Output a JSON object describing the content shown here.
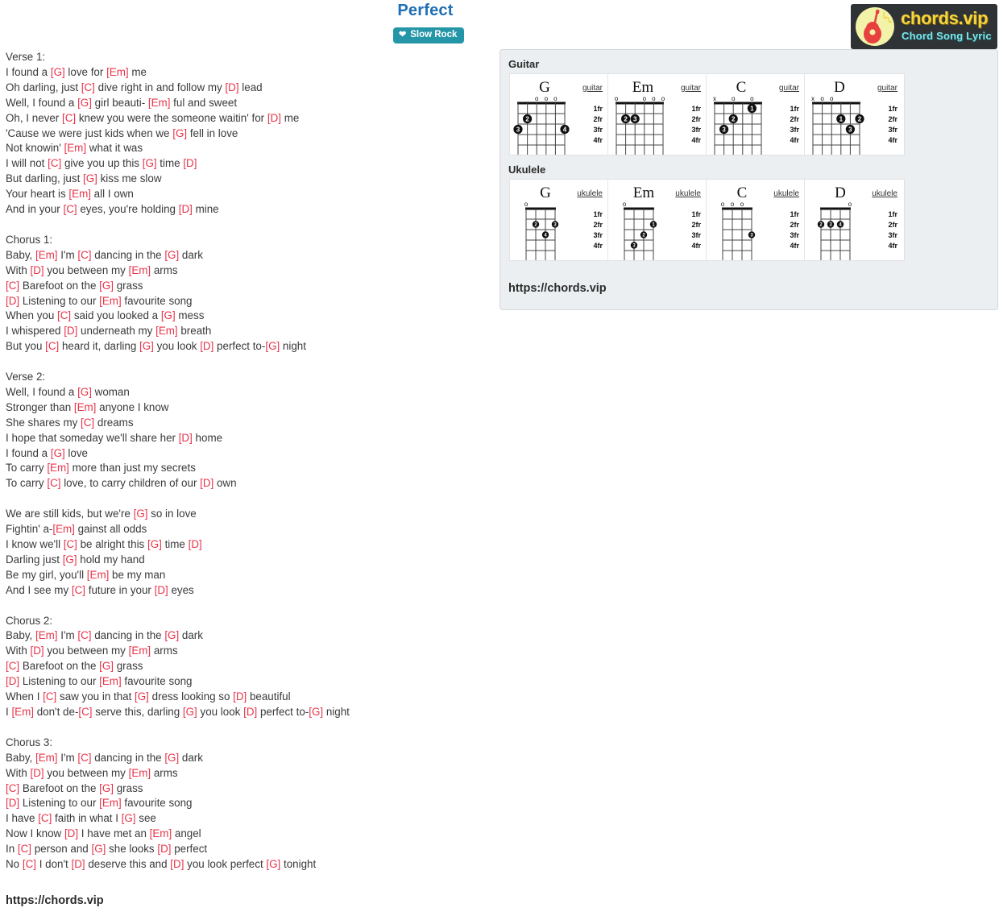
{
  "header": {
    "title": "Perfect",
    "rhythm_badge": "Slow Rock",
    "rhythm_icon": "heart-icon"
  },
  "logo": {
    "brand": "chords.vip",
    "tagline": "Chord Song Lyric",
    "icon": "guitar-icon",
    "brand_color": "#f5d442",
    "tagline_color": "#7fe3e8",
    "background_color": "#2f3336"
  },
  "colors": {
    "title": "#1f6fb5",
    "badge": "#2596a8",
    "chord": "#e8344a",
    "lyric": "#3a3a3a",
    "panel_bg": "#eceff1"
  },
  "bottom_url": "https://chords.vip",
  "chord_panel": {
    "guitar_label": "Guitar",
    "ukulele_label": "Ukulele",
    "url": "https://chords.vip",
    "guitar": [
      {
        "name": "G",
        "instrument": "guitar",
        "strings": 6,
        "frets": 4,
        "fret_labels": [
          "1fr",
          "2fr",
          "3fr",
          "4fr"
        ],
        "open": [
          3,
          4,
          5
        ],
        "muted": [],
        "dots": [
          {
            "string": 2,
            "fret": 2,
            "finger": "2"
          },
          {
            "string": 1,
            "fret": 3,
            "finger": "3"
          },
          {
            "string": 6,
            "fret": 3,
            "finger": "4"
          }
        ]
      },
      {
        "name": "Em",
        "instrument": "guitar",
        "strings": 6,
        "frets": 4,
        "fret_labels": [
          "1fr",
          "2fr",
          "3fr",
          "4fr"
        ],
        "open": [
          1,
          4,
          5,
          6
        ],
        "muted": [],
        "dots": [
          {
            "string": 2,
            "fret": 2,
            "finger": "2"
          },
          {
            "string": 3,
            "fret": 2,
            "finger": "3"
          }
        ]
      },
      {
        "name": "C",
        "instrument": "guitar",
        "strings": 6,
        "frets": 4,
        "fret_labels": [
          "1fr",
          "2fr",
          "3fr",
          "4fr"
        ],
        "open": [
          3,
          5
        ],
        "muted": [
          1
        ],
        "dots": [
          {
            "string": 5,
            "fret": 1,
            "finger": "1"
          },
          {
            "string": 3,
            "fret": 2,
            "finger": "2"
          },
          {
            "string": 2,
            "fret": 3,
            "finger": "3"
          }
        ]
      },
      {
        "name": "D",
        "instrument": "guitar",
        "strings": 6,
        "frets": 4,
        "fret_labels": [
          "1fr",
          "2fr",
          "3fr",
          "4fr"
        ],
        "open": [
          2,
          3
        ],
        "muted": [
          1
        ],
        "dots": [
          {
            "string": 4,
            "fret": 2,
            "finger": "1"
          },
          {
            "string": 6,
            "fret": 2,
            "finger": "2"
          },
          {
            "string": 5,
            "fret": 3,
            "finger": "3"
          }
        ]
      }
    ],
    "ukulele": [
      {
        "name": "G",
        "instrument": "ukulele",
        "strings": 4,
        "frets": 4,
        "fret_labels": [
          "1fr",
          "2fr",
          "3fr",
          "4fr"
        ],
        "open": [
          1
        ],
        "muted": [],
        "dots": [
          {
            "string": 2,
            "fret": 2,
            "finger": "2"
          },
          {
            "string": 4,
            "fret": 2,
            "finger": "3"
          },
          {
            "string": 3,
            "fret": 3,
            "finger": "4"
          }
        ]
      },
      {
        "name": "Em",
        "instrument": "ukulele",
        "strings": 4,
        "frets": 4,
        "fret_labels": [
          "1fr",
          "2fr",
          "3fr",
          "4fr"
        ],
        "open": [
          1
        ],
        "muted": [],
        "dots": [
          {
            "string": 4,
            "fret": 2,
            "finger": "1"
          },
          {
            "string": 3,
            "fret": 3,
            "finger": "2"
          },
          {
            "string": 2,
            "fret": 4,
            "finger": "3"
          }
        ]
      },
      {
        "name": "C",
        "instrument": "ukulele",
        "strings": 4,
        "frets": 4,
        "fret_labels": [
          "1fr",
          "2fr",
          "3fr",
          "4fr"
        ],
        "open": [
          1,
          2,
          3
        ],
        "muted": [],
        "dots": [
          {
            "string": 4,
            "fret": 3,
            "finger": "3"
          }
        ]
      },
      {
        "name": "D",
        "instrument": "ukulele",
        "strings": 4,
        "frets": 4,
        "fret_labels": [
          "1fr",
          "2fr",
          "3fr",
          "4fr"
        ],
        "open": [
          4
        ],
        "muted": [],
        "dots": [
          {
            "string": 1,
            "fret": 2,
            "finger": "2"
          },
          {
            "string": 2,
            "fret": 2,
            "finger": "3"
          },
          {
            "string": 3,
            "fret": 2,
            "finger": "4"
          }
        ]
      }
    ]
  },
  "lyrics": [
    [
      {
        "t": "Verse 1:"
      }
    ],
    [
      {
        "t": "I found a "
      },
      {
        "c": "[G]"
      },
      {
        "t": " love for "
      },
      {
        "c": "[Em]"
      },
      {
        "t": " me"
      }
    ],
    [
      {
        "t": "Oh darling, just "
      },
      {
        "c": "[C]"
      },
      {
        "t": " dive right in and follow my "
      },
      {
        "c": "[D]"
      },
      {
        "t": " lead"
      }
    ],
    [
      {
        "t": "Well, I found a "
      },
      {
        "c": "[G]"
      },
      {
        "t": " girl beauti- "
      },
      {
        "c": "[Em]"
      },
      {
        "t": " ful and sweet"
      }
    ],
    [
      {
        "t": "Oh, I never "
      },
      {
        "c": "[C]"
      },
      {
        "t": " knew you were the someone waitin' for "
      },
      {
        "c": "[D]"
      },
      {
        "t": " me"
      }
    ],
    [
      {
        "t": "'Cause we were just kids when we "
      },
      {
        "c": "[G]"
      },
      {
        "t": " fell in love"
      }
    ],
    [
      {
        "t": "Not knowin' "
      },
      {
        "c": "[Em]"
      },
      {
        "t": " what it was"
      }
    ],
    [
      {
        "t": "I will not "
      },
      {
        "c": "[C]"
      },
      {
        "t": " give you up this "
      },
      {
        "c": "[G]"
      },
      {
        "t": " time "
      },
      {
        "c": "[D]"
      }
    ],
    [
      {
        "t": "But darling, just "
      },
      {
        "c": "[G]"
      },
      {
        "t": " kiss me slow"
      }
    ],
    [
      {
        "t": "Your heart is "
      },
      {
        "c": "[Em]"
      },
      {
        "t": " all I own"
      }
    ],
    [
      {
        "t": "And in your "
      },
      {
        "c": "[C]"
      },
      {
        "t": " eyes, you're holding "
      },
      {
        "c": "[D]"
      },
      {
        "t": " mine"
      }
    ],
    [],
    [
      {
        "t": "Chorus 1:"
      }
    ],
    [
      {
        "t": "Baby, "
      },
      {
        "c": "[Em]"
      },
      {
        "t": " I'm "
      },
      {
        "c": "[C]"
      },
      {
        "t": " dancing in the "
      },
      {
        "c": "[G]"
      },
      {
        "t": " dark"
      }
    ],
    [
      {
        "t": "With "
      },
      {
        "c": "[D]"
      },
      {
        "t": " you between my "
      },
      {
        "c": "[Em]"
      },
      {
        "t": " arms"
      }
    ],
    [
      {
        "c": "[C]"
      },
      {
        "t": " Barefoot on the "
      },
      {
        "c": "[G]"
      },
      {
        "t": " grass"
      }
    ],
    [
      {
        "c": "[D]"
      },
      {
        "t": " Listening to our "
      },
      {
        "c": "[Em]"
      },
      {
        "t": " favourite song"
      }
    ],
    [
      {
        "t": "When you "
      },
      {
        "c": "[C]"
      },
      {
        "t": " said you looked a "
      },
      {
        "c": "[G]"
      },
      {
        "t": " mess"
      }
    ],
    [
      {
        "t": "I whispered "
      },
      {
        "c": "[D]"
      },
      {
        "t": " underneath my "
      },
      {
        "c": "[Em]"
      },
      {
        "t": " breath"
      }
    ],
    [
      {
        "t": "But you "
      },
      {
        "c": "[C]"
      },
      {
        "t": " heard it, darling "
      },
      {
        "c": "[G]"
      },
      {
        "t": " you look "
      },
      {
        "c": "[D]"
      },
      {
        "t": " perfect to-"
      },
      {
        "c": "[G]"
      },
      {
        "t": " night"
      }
    ],
    [],
    [
      {
        "t": "Verse 2:"
      }
    ],
    [
      {
        "t": "Well, I found a "
      },
      {
        "c": "[G]"
      },
      {
        "t": " woman"
      }
    ],
    [
      {
        "t": "Stronger than "
      },
      {
        "c": "[Em]"
      },
      {
        "t": " anyone I know"
      }
    ],
    [
      {
        "t": "She shares my "
      },
      {
        "c": "[C]"
      },
      {
        "t": " dreams"
      }
    ],
    [
      {
        "t": "I hope that someday we'll share her "
      },
      {
        "c": "[D]"
      },
      {
        "t": " home"
      }
    ],
    [
      {
        "t": "I found a "
      },
      {
        "c": "[G]"
      },
      {
        "t": " love"
      }
    ],
    [
      {
        "t": "To carry "
      },
      {
        "c": "[Em]"
      },
      {
        "t": " more than just my secrets"
      }
    ],
    [
      {
        "t": "To carry "
      },
      {
        "c": "[C]"
      },
      {
        "t": " love, to carry children of our "
      },
      {
        "c": "[D]"
      },
      {
        "t": " own"
      }
    ],
    [],
    [
      {
        "t": "We are still kids, but we're "
      },
      {
        "c": "[G]"
      },
      {
        "t": " so in love"
      }
    ],
    [
      {
        "t": "Fightin' a-"
      },
      {
        "c": "[Em]"
      },
      {
        "t": " gainst all odds"
      }
    ],
    [
      {
        "t": "I know we'll "
      },
      {
        "c": "[C]"
      },
      {
        "t": " be alright this "
      },
      {
        "c": "[G]"
      },
      {
        "t": " time "
      },
      {
        "c": "[D]"
      }
    ],
    [
      {
        "t": "Darling just "
      },
      {
        "c": "[G]"
      },
      {
        "t": " hold my hand"
      }
    ],
    [
      {
        "t": "Be my girl, you'll "
      },
      {
        "c": "[Em]"
      },
      {
        "t": " be my man"
      }
    ],
    [
      {
        "t": "And I see my "
      },
      {
        "c": "[C]"
      },
      {
        "t": " future in your "
      },
      {
        "c": "[D]"
      },
      {
        "t": " eyes"
      }
    ],
    [],
    [
      {
        "t": "Chorus 2:"
      }
    ],
    [
      {
        "t": "Baby, "
      },
      {
        "c": "[Em]"
      },
      {
        "t": " I'm "
      },
      {
        "c": "[C]"
      },
      {
        "t": " dancing in the "
      },
      {
        "c": "[G]"
      },
      {
        "t": " dark"
      }
    ],
    [
      {
        "t": "With "
      },
      {
        "c": "[D]"
      },
      {
        "t": " you between my "
      },
      {
        "c": "[Em]"
      },
      {
        "t": " arms"
      }
    ],
    [
      {
        "c": "[C]"
      },
      {
        "t": " Barefoot on the "
      },
      {
        "c": "[G]"
      },
      {
        "t": " grass"
      }
    ],
    [
      {
        "c": "[D]"
      },
      {
        "t": " Listening to our "
      },
      {
        "c": "[Em]"
      },
      {
        "t": " favourite song"
      }
    ],
    [
      {
        "t": "When I "
      },
      {
        "c": "[C]"
      },
      {
        "t": " saw you in that "
      },
      {
        "c": "[G]"
      },
      {
        "t": " dress looking so "
      },
      {
        "c": "[D]"
      },
      {
        "t": " beautiful"
      }
    ],
    [
      {
        "t": "I "
      },
      {
        "c": "[Em]"
      },
      {
        "t": " don't de-"
      },
      {
        "c": "[C]"
      },
      {
        "t": " serve this, darling "
      },
      {
        "c": "[G]"
      },
      {
        "t": " you look "
      },
      {
        "c": "[D]"
      },
      {
        "t": " perfect to-"
      },
      {
        "c": "[G]"
      },
      {
        "t": " night"
      }
    ],
    [],
    [
      {
        "t": "Chorus 3:"
      }
    ],
    [
      {
        "t": "Baby, "
      },
      {
        "c": "[Em]"
      },
      {
        "t": " I'm "
      },
      {
        "c": "[C]"
      },
      {
        "t": " dancing in the "
      },
      {
        "c": "[G]"
      },
      {
        "t": " dark"
      }
    ],
    [
      {
        "t": "With "
      },
      {
        "c": "[D]"
      },
      {
        "t": " you between my "
      },
      {
        "c": "[Em]"
      },
      {
        "t": " arms"
      }
    ],
    [
      {
        "c": "[C]"
      },
      {
        "t": " Barefoot on the "
      },
      {
        "c": "[G]"
      },
      {
        "t": " grass"
      }
    ],
    [
      {
        "c": "[D]"
      },
      {
        "t": " Listening to our "
      },
      {
        "c": "[Em]"
      },
      {
        "t": " favourite song"
      }
    ],
    [
      {
        "t": "I have "
      },
      {
        "c": "[C]"
      },
      {
        "t": " faith in what I "
      },
      {
        "c": "[G]"
      },
      {
        "t": " see"
      }
    ],
    [
      {
        "t": "Now I know "
      },
      {
        "c": "[D]"
      },
      {
        "t": " I have met an "
      },
      {
        "c": "[Em]"
      },
      {
        "t": " angel"
      }
    ],
    [
      {
        "t": "In "
      },
      {
        "c": "[C]"
      },
      {
        "t": " person and "
      },
      {
        "c": "[G]"
      },
      {
        "t": " she looks "
      },
      {
        "c": "[D]"
      },
      {
        "t": " perfect"
      }
    ],
    [
      {
        "t": "No "
      },
      {
        "c": "[C]"
      },
      {
        "t": " I don't "
      },
      {
        "c": "[D]"
      },
      {
        "t": " deserve this and "
      },
      {
        "c": "[D]"
      },
      {
        "t": " you look perfect "
      },
      {
        "c": "[G]"
      },
      {
        "t": " tonight"
      }
    ]
  ]
}
